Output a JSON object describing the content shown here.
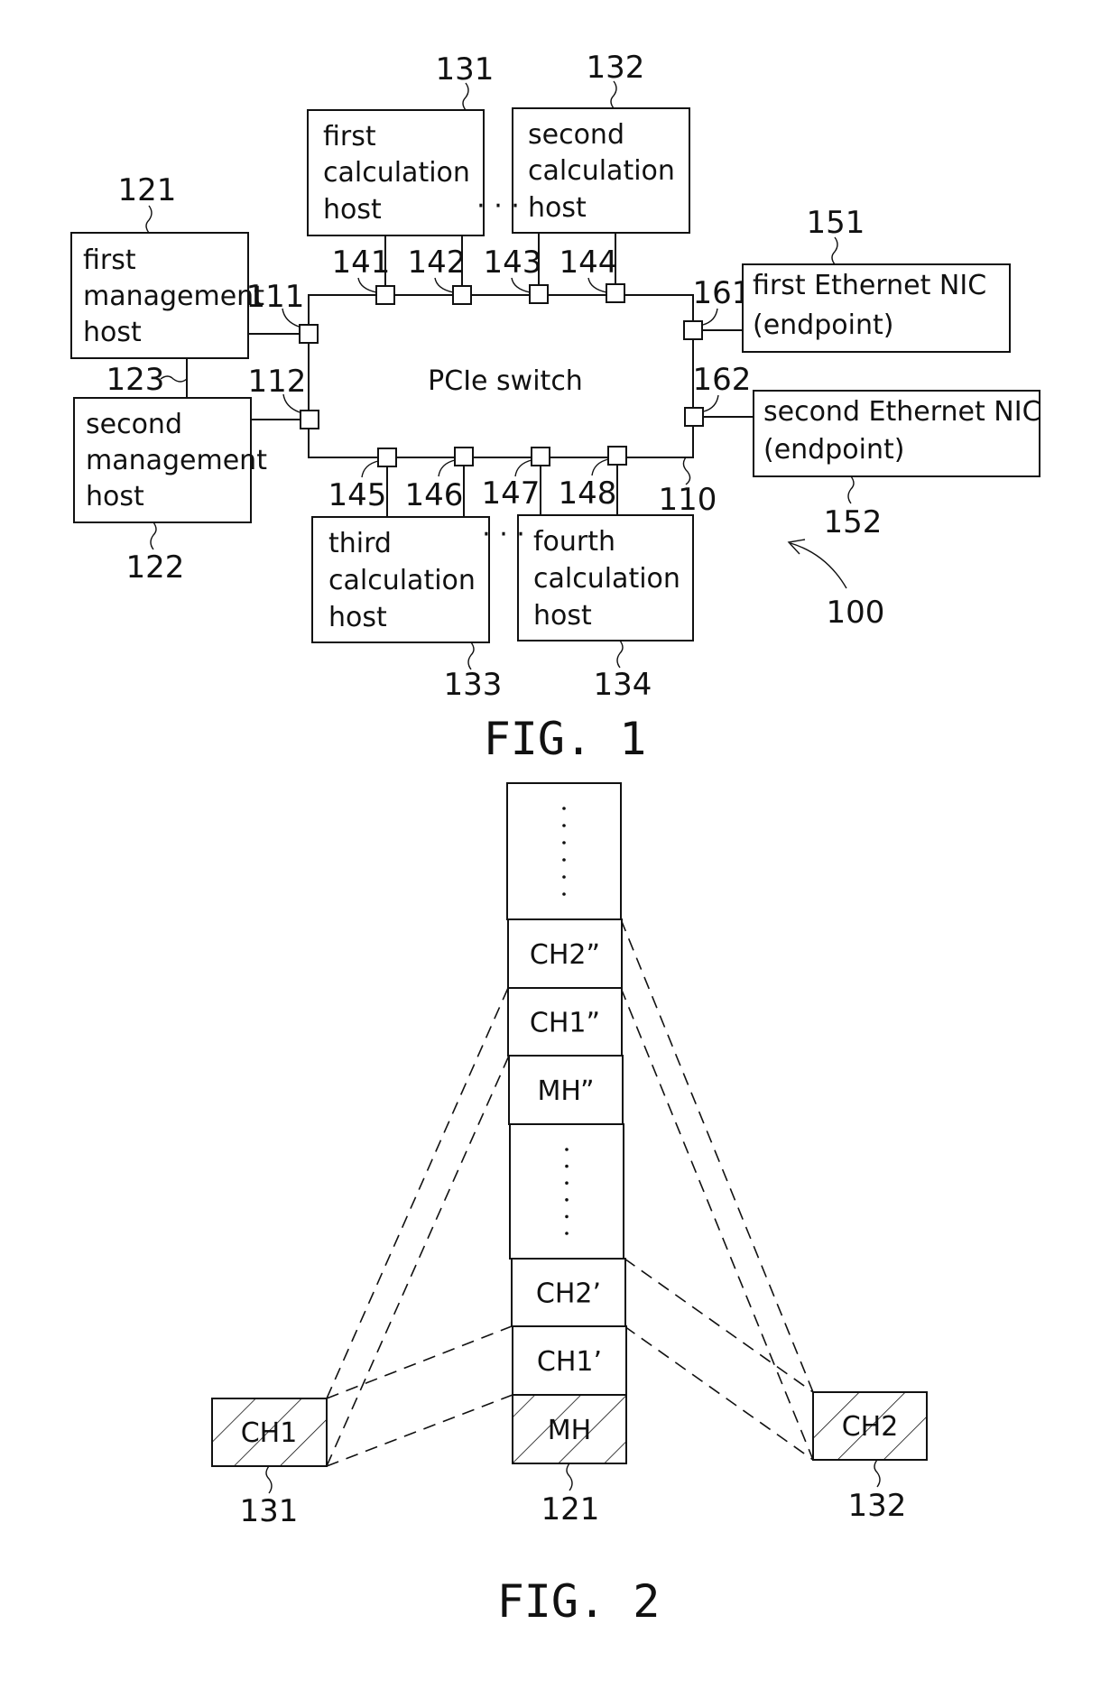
{
  "fig1": {
    "caption": "FIG. 1",
    "system_ref": "100",
    "switch": {
      "label": "PCIe switch",
      "ref": "110"
    },
    "management_hosts": [
      {
        "ref": "121",
        "lines": [
          "first",
          "management",
          "host"
        ]
      },
      {
        "ref": "122",
        "lines": [
          "second",
          "management",
          "host"
        ]
      }
    ],
    "management_link_ref": "123",
    "calculation_hosts": [
      {
        "ref": "131",
        "lines": [
          "first",
          "calculation",
          "host"
        ]
      },
      {
        "ref": "132",
        "lines": [
          "second",
          "calculation",
          "host"
        ]
      },
      {
        "ref": "133",
        "lines": [
          "third",
          "calculation",
          "host"
        ]
      },
      {
        "ref": "134",
        "lines": [
          "fourth",
          "calculation",
          "host"
        ]
      }
    ],
    "nics": [
      {
        "ref": "151",
        "lines": [
          "first Ethernet NIC",
          "(endpoint)"
        ]
      },
      {
        "ref": "152",
        "lines": [
          "second Ethernet NIC",
          "(endpoint)"
        ]
      }
    ],
    "ports": {
      "management": [
        "111",
        "112"
      ],
      "top": [
        "141",
        "142",
        "143",
        "144"
      ],
      "bottom": [
        "145",
        "146",
        "147",
        "148"
      ],
      "nic": [
        "161",
        "162"
      ]
    },
    "ellipsis": "· · ·"
  },
  "fig2": {
    "caption": "FIG. 2",
    "column_ref": "121",
    "column_cells": [
      {
        "label": "",
        "kind": "dots"
      },
      {
        "label": "CH2”",
        "kind": "text"
      },
      {
        "label": "CH1”",
        "kind": "text"
      },
      {
        "label": "MH”",
        "kind": "text"
      },
      {
        "label": "",
        "kind": "dots"
      },
      {
        "label": "CH2’",
        "kind": "text"
      },
      {
        "label": "CH1’",
        "kind": "text"
      },
      {
        "label": "MH",
        "kind": "hatched"
      }
    ],
    "left_block": {
      "label": "CH1",
      "ref": "131"
    },
    "right_block": {
      "label": "CH2",
      "ref": "132"
    }
  }
}
